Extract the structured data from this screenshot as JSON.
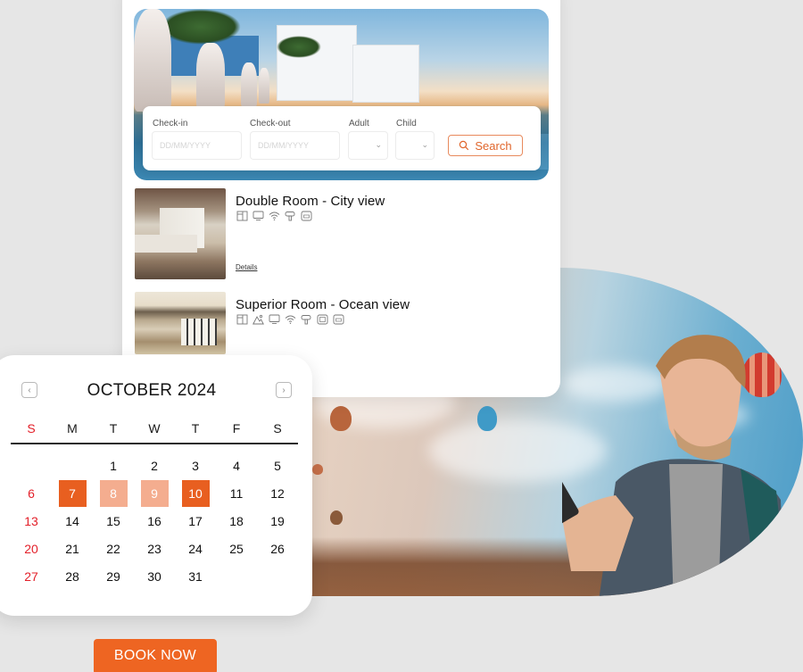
{
  "booking_form": {
    "checkin": {
      "label": "Check-in",
      "placeholder": "DD/MM/YYYY",
      "value": ""
    },
    "checkout": {
      "label": "Check-out",
      "placeholder": "DD/MM/YYYY",
      "value": ""
    },
    "adult": {
      "label": "Adult",
      "value": ""
    },
    "child": {
      "label": "Child",
      "value": ""
    },
    "search_label": "Search"
  },
  "rooms": [
    {
      "title": "Double Room - City view",
      "amenities": [
        "minibar-icon",
        "tv-icon",
        "wifi-icon",
        "hairdryer-icon",
        "air-conditioning-icon"
      ],
      "details_label": "Details"
    },
    {
      "title": "Superior Room - Ocean view",
      "amenities": [
        "minibar-icon",
        "mountain-view-icon",
        "tv-icon",
        "wifi-icon",
        "hairdryer-icon",
        "safe-icon",
        "air-conditioning-icon"
      ]
    }
  ],
  "calendar": {
    "title": "OCTOBER 2024",
    "prev_icon": "chevron-left-icon",
    "next_icon": "chevron-right-icon",
    "weekdays": [
      "S",
      "M",
      "T",
      "W",
      "T",
      "F",
      "S"
    ],
    "weeks": [
      [
        "",
        "",
        "1",
        "2",
        "3",
        "4",
        "5"
      ],
      [
        "6",
        "7",
        "8",
        "9",
        "10",
        "11",
        "12"
      ],
      [
        "13",
        "14",
        "15",
        "16",
        "17",
        "18",
        "19"
      ],
      [
        "20",
        "21",
        "22",
        "23",
        "24",
        "25",
        "26"
      ],
      [
        "27",
        "28",
        "29",
        "30",
        "31",
        "",
        ""
      ]
    ],
    "selected_start": "7",
    "selected_end": "10",
    "in_range": [
      "8",
      "9"
    ]
  },
  "book_now_label": "BOOK NOW",
  "colors": {
    "accent": "#ee6522",
    "range": "#f4ad8f",
    "sunday": "#e3202a"
  }
}
